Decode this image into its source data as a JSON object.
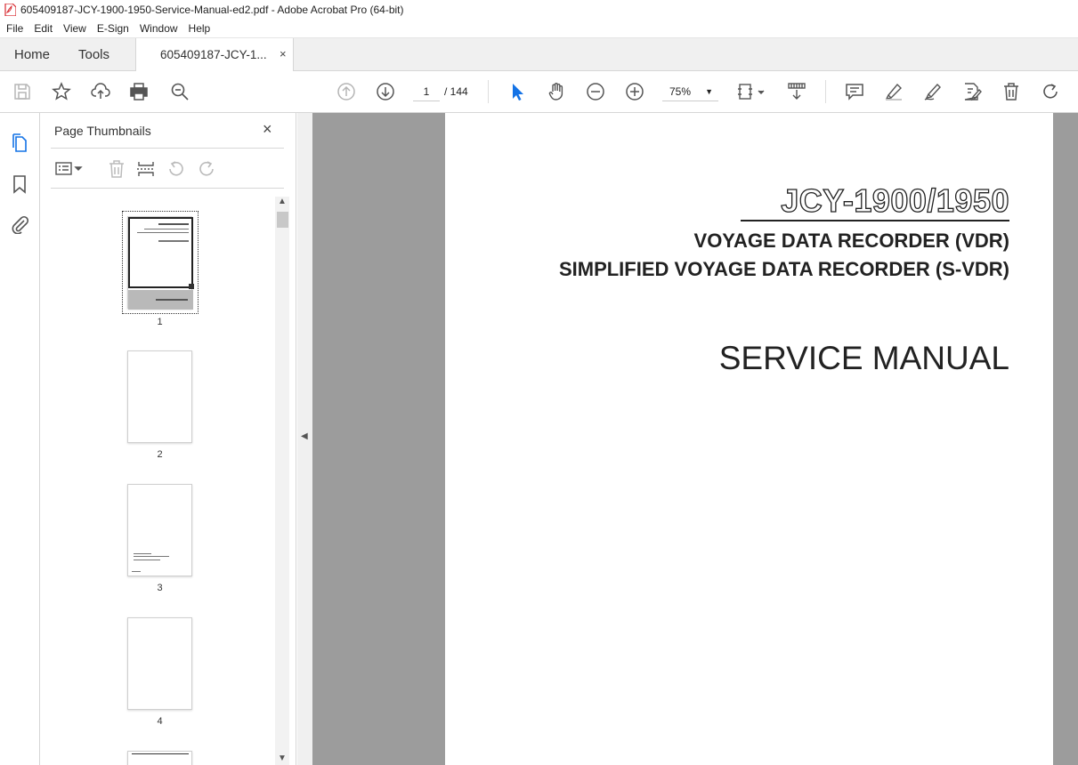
{
  "window": {
    "title": "605409187-JCY-1900-1950-Service-Manual-ed2.pdf - Adobe Acrobat Pro (64-bit)"
  },
  "menu": [
    "File",
    "Edit",
    "View",
    "E-Sign",
    "Window",
    "Help"
  ],
  "tabs": {
    "home": "Home",
    "tools": "Tools",
    "document": "605409187-JCY-1...",
    "close": "×"
  },
  "toolbar": {
    "current_page": "1",
    "page_total": "/ 144",
    "zoom": "75%"
  },
  "thumbnails_panel": {
    "title": "Page Thumbnails",
    "close": "×",
    "pages": [
      "1",
      "2",
      "3",
      "4"
    ]
  },
  "document": {
    "model": "JCY-1900/1950",
    "subtitle_1": "VOYAGE DATA RECORDER (VDR)",
    "subtitle_2": "SIMPLIFIED VOYAGE DATA RECORDER (S-VDR)",
    "manual": "SERVICE MANUAL"
  },
  "colors": {
    "accent": "#1473e6",
    "pdf_red": "#d7282f",
    "doc_background": "#9c9c9c"
  }
}
